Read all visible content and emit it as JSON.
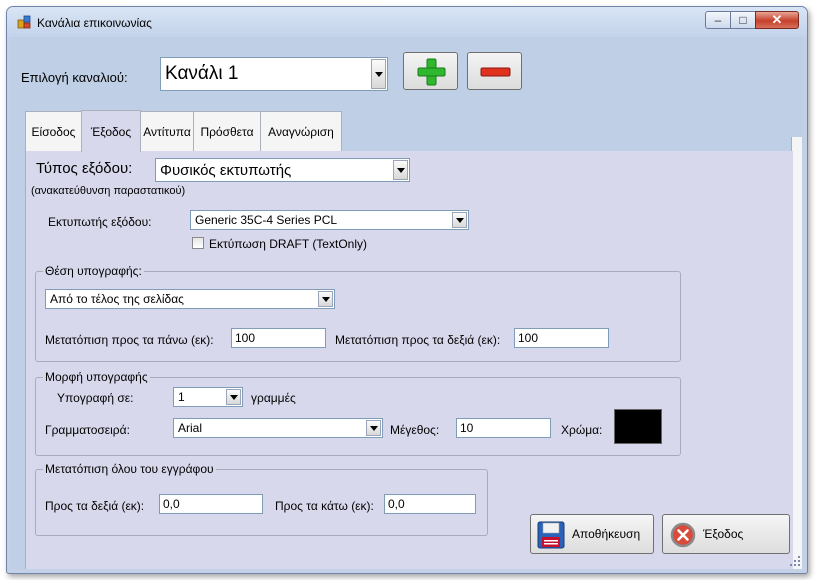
{
  "window": {
    "title": "Κανάλια επικοινωνίας"
  },
  "channel": {
    "label": "Επιλογή καναλιού:",
    "value": "Κανάλι 1"
  },
  "tabs": [
    {
      "label": "Είσοδος"
    },
    {
      "label": "Έξοδος"
    },
    {
      "label": "Αντίτυπα"
    },
    {
      "label": "Πρόσθετα"
    },
    {
      "label": "Αναγνώριση"
    }
  ],
  "output": {
    "type_label": "Τύπος εξόδου:",
    "type_value": "Φυσικός εκτυπωτής",
    "redirect_note": "(ανακατεύθυνση παραστατικού)",
    "printer_label": "Εκτυπωτής εξόδου:",
    "printer_value": "Generic 35C-4 Series PCL",
    "draft_label": "Εκτύπωση DRAFT (TextOnly)",
    "draft_checked": false
  },
  "signature_position": {
    "title": "Θέση υπογραφής:",
    "mode_value": "Από το τέλος της σελίδας",
    "up_label": "Μετατόπιση προς τα πάνω (εκ):",
    "up_value": "100",
    "right_label": "Μετατόπιση προς τα δεξιά (εκ):",
    "right_value": "100"
  },
  "signature_format": {
    "title": "Μορφή υπογραφής",
    "sign_on_label": "Υπογραφή σε:",
    "lines_value": "1",
    "lines_unit": "γραμμές",
    "font_label": "Γραμματοσειρά:",
    "font_value": "Arial",
    "size_label": "Μέγεθος:",
    "size_value": "10",
    "color_label": "Χρώμα:",
    "color_value": "#000000"
  },
  "document_offset": {
    "title": "Μετατόπιση όλου του εγγράφου",
    "right_label": "Προς τα δεξιά (εκ):",
    "right_value": "0,0",
    "down_label": "Προς τα κάτω (εκ):",
    "down_value": "0,0"
  },
  "actions": {
    "save_label": "Αποθήκευση",
    "exit_label": "Έξοδος"
  },
  "colors": {
    "add": "#2db82d",
    "remove": "#e0301e",
    "tab_panel": "#d8d8ec",
    "frame": "#bfcfe6"
  }
}
